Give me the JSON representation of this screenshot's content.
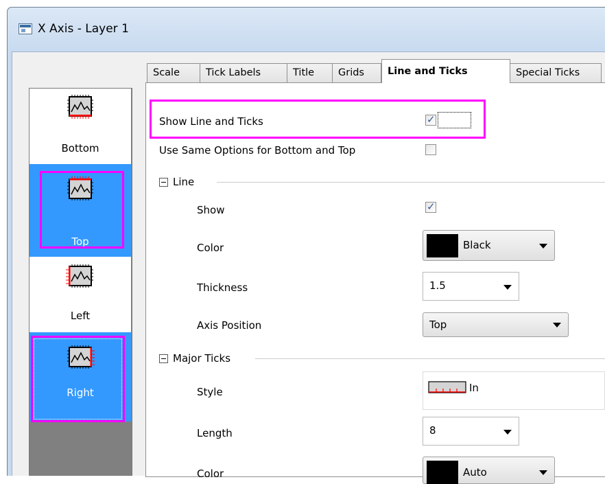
{
  "window": {
    "title": "X Axis - Layer 1"
  },
  "axis_list": [
    {
      "label": "Bottom",
      "icon": "axis-bottom-icon",
      "selected": false
    },
    {
      "label": "Top",
      "icon": "axis-top-icon",
      "selected": true
    },
    {
      "label": "Left",
      "icon": "axis-left-icon",
      "selected": false
    },
    {
      "label": "Right",
      "icon": "axis-right-icon",
      "selected": true
    }
  ],
  "tabs": [
    {
      "label": "Scale",
      "active": false
    },
    {
      "label": "Tick Labels",
      "active": false
    },
    {
      "label": "Title",
      "active": false
    },
    {
      "label": "Grids",
      "active": false
    },
    {
      "label": "Line and Ticks",
      "active": true
    },
    {
      "label": "Special Ticks",
      "active": false
    }
  ],
  "panel": {
    "show_line_ticks": {
      "label": "Show Line and Ticks",
      "checked": true
    },
    "same_options": {
      "label": "Use Same Options for Bottom and Top",
      "checked": false
    },
    "line_group": {
      "title": "Line",
      "show": {
        "label": "Show",
        "checked": true
      },
      "color": {
        "label": "Color",
        "value": "Black",
        "swatch": "#000000"
      },
      "thickness": {
        "label": "Thickness",
        "value": "1.5"
      },
      "axis_position": {
        "label": "Axis Position",
        "value": "Top"
      }
    },
    "major_ticks_group": {
      "title": "Major Ticks",
      "style": {
        "label": "Style",
        "value": "In"
      },
      "length": {
        "label": "Length",
        "value": "8"
      },
      "color": {
        "label": "Color",
        "value": "Auto",
        "swatch": "#000000"
      }
    }
  },
  "colors": {
    "highlight": "#ff00ff",
    "selection": "#3399ff",
    "axis_red": "#ff0000"
  }
}
